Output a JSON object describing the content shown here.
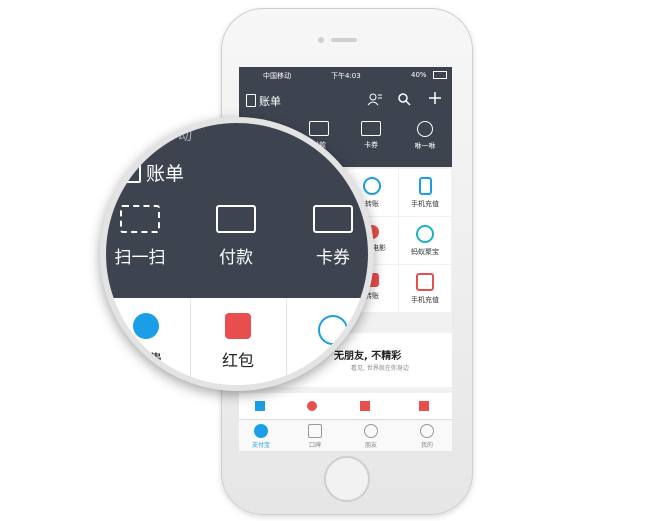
{
  "status_bar": {
    "carrier": "中国移动",
    "time": "下午4:03",
    "battery": "40%"
  },
  "nav": {
    "title": "账单"
  },
  "top_actions": [
    {
      "label": "付款",
      "icon": "barcode-icon"
    },
    {
      "label": "卡券",
      "icon": "card-icon"
    },
    {
      "label": "咻一咻",
      "icon": "target-icon"
    }
  ],
  "grid": [
    {
      "label": "转账",
      "icon": "transfer-icon",
      "color": "#1a9ee8"
    },
    {
      "label": "手机充值",
      "icon": "phone-icon",
      "color": "#1a9ee8"
    },
    {
      "label": "淘宝电影",
      "icon": "movie-icon",
      "color": "#e84e4e"
    },
    {
      "label": "蚂蚁聚宝",
      "icon": "ant-icon",
      "color": "#1ab0c8"
    },
    {
      "label": "转账",
      "icon": "redpacket-icon",
      "color": "#e84e4e"
    },
    {
      "label": "手机充值",
      "icon": "gift-icon",
      "color": "#e84e4e"
    }
  ],
  "banner": {
    "headline": "无朋友, 不精彩",
    "subline": "看见, 世界就在你身边"
  },
  "tabs": [
    {
      "label": "支付宝",
      "active": true
    },
    {
      "label": "口碑",
      "active": false
    },
    {
      "label": "朋友",
      "active": false
    },
    {
      "label": "我的",
      "active": false
    }
  ],
  "magnifier": {
    "carrier": "移动",
    "bill_title": "账单",
    "actions": [
      "扫一扫",
      "付款",
      "卡券"
    ],
    "items": [
      "缴费",
      "红包"
    ]
  }
}
